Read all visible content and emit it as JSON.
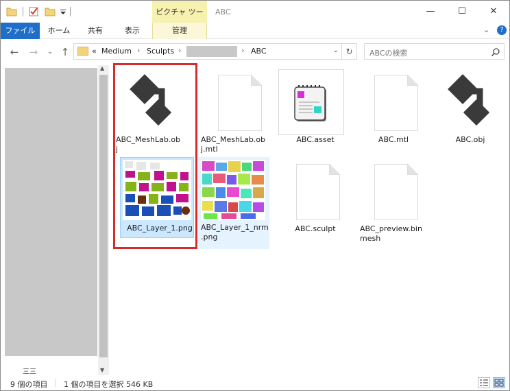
{
  "window": {
    "title": "ABC",
    "context_tab_group": "ピクチャ ツール",
    "controls": {
      "minimize": "—",
      "maximize": "☐",
      "close": "✕"
    }
  },
  "ribbon": {
    "tabs": [
      "ファイル",
      "ホーム",
      "共有",
      "表示",
      "管理"
    ],
    "expand": "⌄",
    "help": "?"
  },
  "nav": {
    "back": "←",
    "forward": "→",
    "recent": "⌄",
    "up": "↑",
    "breadcrumb": {
      "overflow": "«",
      "items": [
        "Medium",
        "Sculpts",
        "ABC"
      ],
      "sep": "›"
    },
    "dropdown": "⌄",
    "refresh": "↻"
  },
  "search": {
    "placeholder": "ABCの検索",
    "icon": "search-icon"
  },
  "navpane": {
    "partial_text": "三三"
  },
  "files": [
    {
      "name": "ABC_MeshLab.obj",
      "label_lines": [
        "ABC_MeshLab.ob",
        "j"
      ],
      "icon": "obj-icon",
      "selected": false
    },
    {
      "name": "ABC_MeshLab.obj.mtl",
      "label_lines": [
        "ABC_MeshLab.ob",
        "j.mtl"
      ],
      "icon": "document-icon",
      "selected": false
    },
    {
      "name": "ABC.asset",
      "label_lines": [
        "ABC.asset"
      ],
      "icon": "asset-icon",
      "selected": false
    },
    {
      "name": "ABC.mtl",
      "label_lines": [
        "ABC.mtl"
      ],
      "icon": "document-icon",
      "selected": false
    },
    {
      "name": "ABC.obj",
      "label_lines": [
        "ABC.obj"
      ],
      "icon": "obj-icon",
      "selected": false
    },
    {
      "name": "ABC_Layer_1.png",
      "label_lines": [
        "ABC_Layer_1.png"
      ],
      "icon": "texture-thumbnail",
      "selected": true
    },
    {
      "name": "ABC_Layer_1_nrm.png",
      "label_lines": [
        "ABC_Layer_1_nrm",
        ".png"
      ],
      "icon": "normal-map-thumbnail",
      "selected": false
    },
    {
      "name": "ABC.sculpt",
      "label_lines": [
        "ABC.sculpt"
      ],
      "icon": "document-icon",
      "selected": false
    },
    {
      "name": "ABC_preview.binmesh",
      "label_lines": [
        "ABC_preview.bin",
        "mesh"
      ],
      "icon": "document-icon",
      "selected": false
    }
  ],
  "status": {
    "item_count": "9 個の項目",
    "selection": "1 個の項目を選択  546 KB"
  },
  "colors": {
    "file_tab": "#1f6ec9",
    "context_tab": "#f7f1b0",
    "selection_bg": "#cce8ff",
    "highlight_box": "#d62b2b",
    "obj_icon": "#3a3a3a"
  }
}
